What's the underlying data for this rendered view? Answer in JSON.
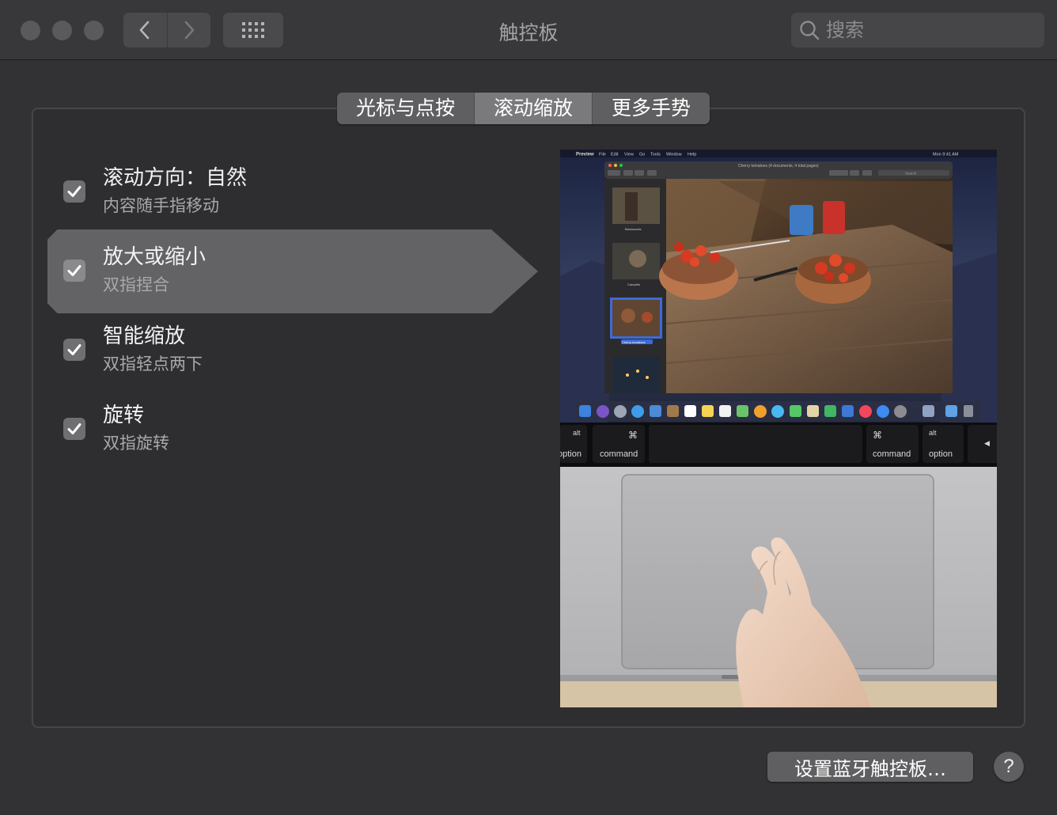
{
  "window": {
    "title": "触控板"
  },
  "search": {
    "placeholder": "搜索",
    "value": ""
  },
  "tabs": [
    {
      "label": "光标与点按",
      "selected": false
    },
    {
      "label": "滚动缩放",
      "selected": true
    },
    {
      "label": "更多手势",
      "selected": false
    }
  ],
  "options": [
    {
      "title": "滚动方向：自然",
      "subtitle": "内容随手指移动",
      "checked": true,
      "highlighted": false
    },
    {
      "title": "放大或缩小",
      "subtitle": "双指捏合",
      "checked": true,
      "highlighted": true
    },
    {
      "title": "智能缩放",
      "subtitle": "双指轻点两下",
      "checked": true,
      "highlighted": false
    },
    {
      "title": "旋转",
      "subtitle": "双指旋转",
      "checked": true,
      "highlighted": false
    }
  ],
  "preview": {
    "menubar": {
      "app": "Preview",
      "items": [
        "File",
        "Edit",
        "View",
        "Go",
        "Tools",
        "Window",
        "Help"
      ],
      "clock": "Mon 9:41 AM"
    },
    "window_title": "Cherry tomatoes (4 documents, 4 total pages)",
    "search_placeholder": "Search",
    "thumbnails": [
      "Backwoods",
      "Campfire",
      "Cherry tomatoes",
      ""
    ],
    "keys": {
      "left_option": "option",
      "left_alt": "alt",
      "left_cmd_symbol": "⌘",
      "left_command": "command",
      "right_cmd_symbol": "⌘",
      "right_command": "command",
      "right_alt": "alt",
      "right_option": "option",
      "arrow": "◀"
    }
  },
  "bottom": {
    "setup_label": "设置蓝牙触控板…",
    "help_label": "?"
  },
  "colors": {
    "window_bg": "#323234",
    "highlight": "#636365",
    "tab_selected": "#7a7a7c"
  }
}
